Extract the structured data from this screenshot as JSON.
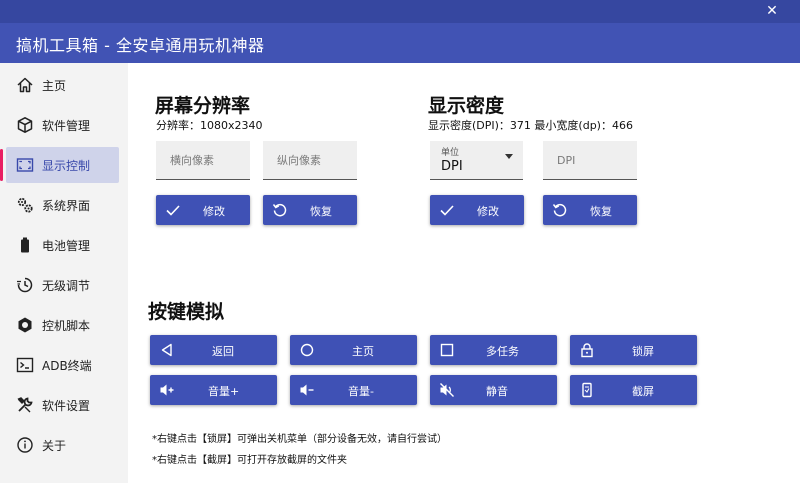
{
  "window": {
    "title": "搞机工具箱 - 全安卓通用玩机神器",
    "close_glyph": "✕"
  },
  "sidebar": {
    "items": [
      {
        "label": "主页",
        "icon": "home-icon"
      },
      {
        "label": "软件管理",
        "icon": "box-icon"
      },
      {
        "label": "显示控制",
        "icon": "screen-icon",
        "active": true
      },
      {
        "label": "系统界面",
        "icon": "gears-icon"
      },
      {
        "label": "电池管理",
        "icon": "battery-icon"
      },
      {
        "label": "无级调节",
        "icon": "timer-icon"
      },
      {
        "label": "控机脚本",
        "icon": "hexagon-icon"
      },
      {
        "label": "ADB终端",
        "icon": "terminal-icon"
      },
      {
        "label": "软件设置",
        "icon": "tools-icon"
      },
      {
        "label": "关于",
        "icon": "info-icon"
      }
    ]
  },
  "resolution": {
    "title": "屏幕分辨率",
    "current": "分辨率：1080x2340",
    "width_placeholder": "横向像素",
    "height_placeholder": "纵向像素",
    "modify_label": "修改",
    "restore_label": "恢复"
  },
  "density": {
    "title": "显示密度",
    "current": "显示密度(DPI)：371   最小宽度(dp)：466",
    "unit_label": "单位",
    "unit_value": "DPI",
    "dpi_placeholder": "DPI",
    "modify_label": "修改",
    "restore_label": "恢复"
  },
  "keys": {
    "title": "按键模拟",
    "back": "返回",
    "home": "主页",
    "recent": "多任务",
    "lock": "锁屏",
    "vol_up": "音量+",
    "vol_down": "音量-",
    "mute": "静音",
    "screenshot": "截屏"
  },
  "notes": {
    "line1": "*右键点击【锁屏】可弹出关机菜单（部分设备无效，请自行尝试）",
    "line2": "*右键点击【截屏】可打开存放截屏的文件夹"
  },
  "colors": {
    "titlebar": "#3647a0",
    "header": "#4153b4",
    "button": "#3f51b5",
    "active_nav_bg": "#cfd3ea",
    "active_marker": "#e91e63"
  }
}
